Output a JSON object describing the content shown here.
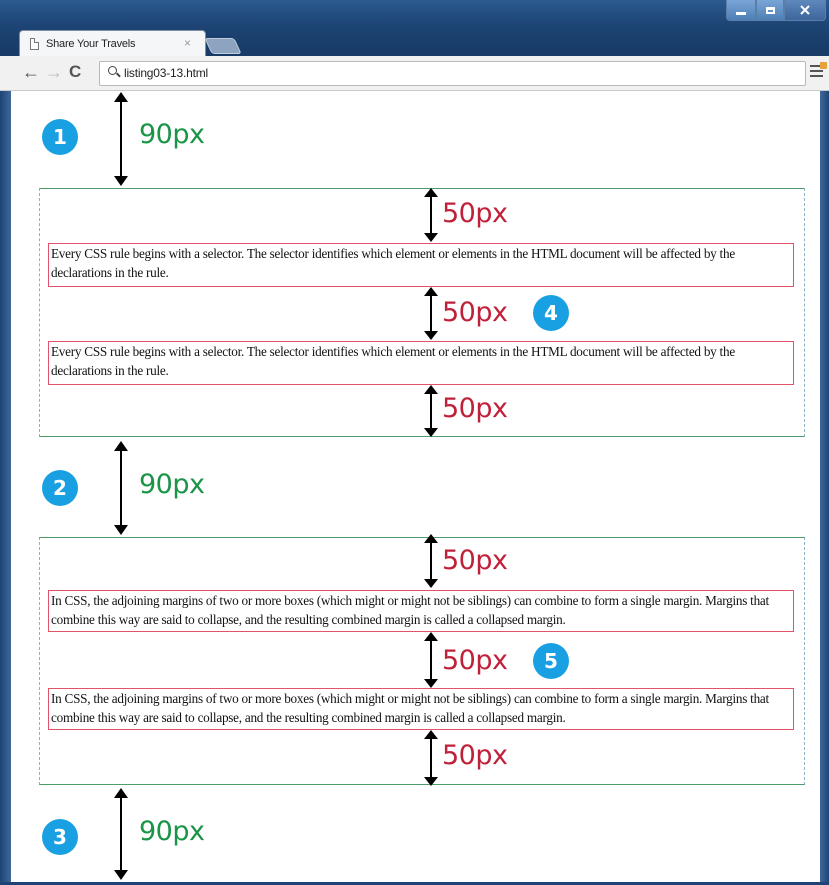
{
  "browser": {
    "tab_title": "Share Your Travels",
    "tab_close": "×",
    "url": "listing03-13.html",
    "nav": {
      "back": "←",
      "forward": "→",
      "reload": "C"
    }
  },
  "annotations": {
    "badges": [
      "1",
      "2",
      "3",
      "4",
      "5"
    ],
    "body_margin_label": "90px",
    "paragraph_margin_label": "50px",
    "colors": {
      "green": "#1a9447",
      "red": "#c0213a",
      "badge": "#19a0e2",
      "paragraph_border": "#e0536a"
    }
  },
  "content": {
    "paragraph_1": "Every CSS rule begins with a selector. The selector identifies which element or elements in the HTML document will be affected by the declarations in the rule.",
    "paragraph_2": "In CSS, the adjoining margins of two or more boxes (which might or might not be siblings) can combine to form a single margin. Margins that combine this way are said to collapse, and the resulting combined margin is called a collapsed margin."
  }
}
